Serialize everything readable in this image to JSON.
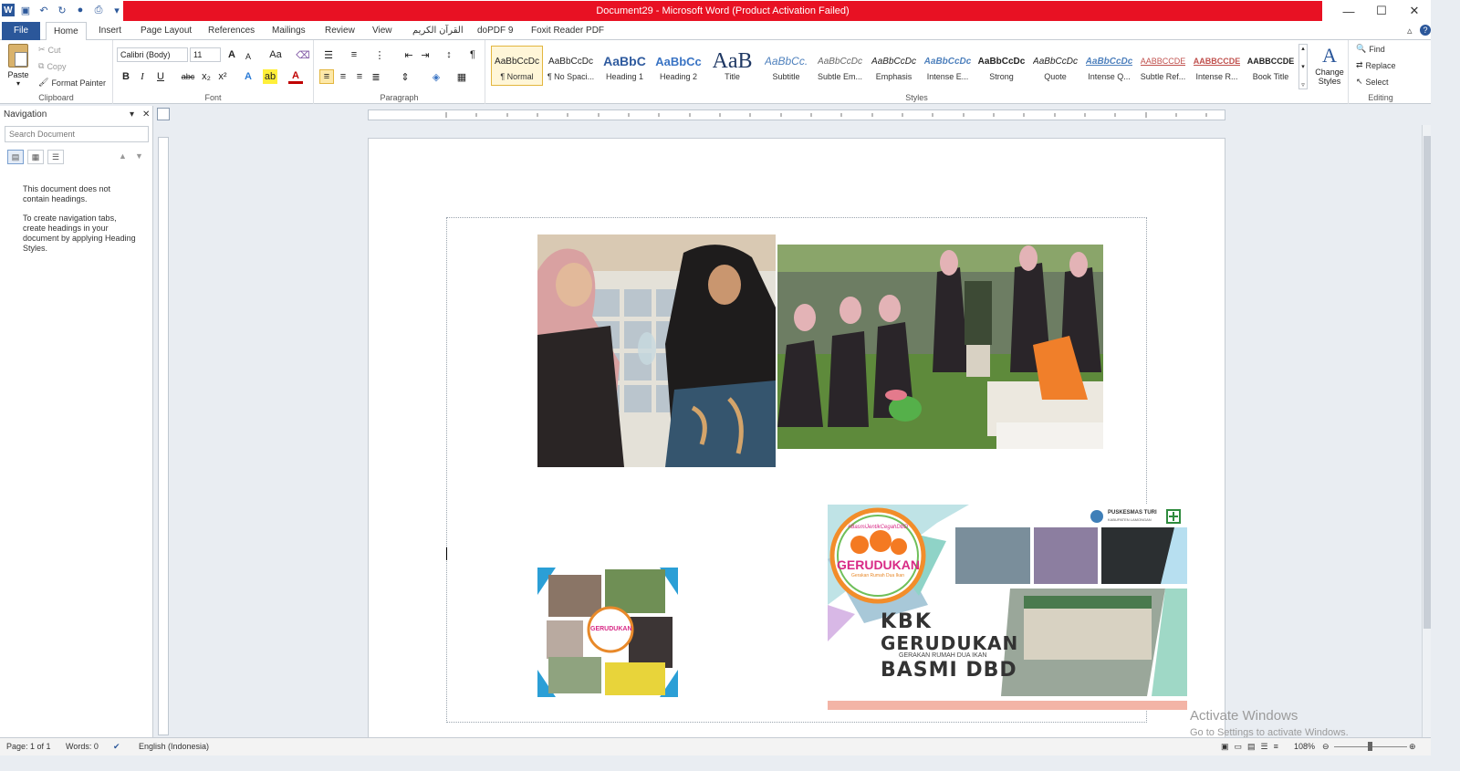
{
  "window": {
    "title": "Document29 - Microsoft Word (Product Activation Failed)",
    "minimize": "—",
    "maximize": "☐",
    "close": "✕"
  },
  "tabs": [
    "File",
    "Home",
    "Insert",
    "Page Layout",
    "References",
    "Mailings",
    "Review",
    "View",
    "القرآن الكريم",
    "doPDF 9",
    "Foxit Reader PDF"
  ],
  "ribbon": {
    "clipboard": {
      "label": "Clipboard",
      "paste": "Paste",
      "cut": "Cut",
      "copy": "Copy",
      "format_painter": "Format Painter"
    },
    "font": {
      "label": "Font",
      "family": "Calibri (Body)",
      "size": "11",
      "bold": "B",
      "italic": "I",
      "underline": "U",
      "strike": "abc",
      "sub": "x₂",
      "sup": "x²",
      "grow": "A",
      "shrink": "A",
      "case": "Aa"
    },
    "paragraph": {
      "label": "Paragraph",
      "pilcrow": "¶"
    },
    "styles": {
      "label": "Styles",
      "items": [
        {
          "preview": "AaBbCcDc",
          "name": "¶ Normal"
        },
        {
          "preview": "AaBbCcDc",
          "name": "¶ No Spaci..."
        },
        {
          "preview": "AaBbC",
          "name": "Heading 1"
        },
        {
          "preview": "AaBbCc",
          "name": "Heading 2"
        },
        {
          "preview": "AaB",
          "name": "Title"
        },
        {
          "preview": "AaBbCc.",
          "name": "Subtitle"
        },
        {
          "preview": "AaBbCcDc",
          "name": "Subtle Em..."
        },
        {
          "preview": "AaBbCcDc",
          "name": "Emphasis"
        },
        {
          "preview": "AaBbCcDc",
          "name": "Intense E..."
        },
        {
          "preview": "AaBbCcDc",
          "name": "Strong"
        },
        {
          "preview": "AaBbCcDc",
          "name": "Quote"
        },
        {
          "preview": "AaBbCcDc",
          "name": "Intense Q..."
        },
        {
          "preview": "AABBCCDE",
          "name": "Subtle Ref..."
        },
        {
          "preview": "AABBCCDE",
          "name": "Intense R..."
        },
        {
          "preview": "AABBCCDE",
          "name": "Book Title"
        }
      ],
      "change_styles": "Change Styles"
    },
    "editing": {
      "label": "Editing",
      "find": "Find",
      "replace": "Replace",
      "select": "Select"
    }
  },
  "navigation": {
    "title": "Navigation",
    "search_placeholder": "Search Document",
    "msg1": "This document does not contain headings.",
    "msg2": "To create navigation tabs, create headings in your document by applying Heading Styles."
  },
  "banner": {
    "hashtag": "#BasmiJentikCegahDBD",
    "logo": "GERUDUKAN",
    "logo_sub": "Gerakan Rumah Dua Ikan",
    "org": "PUSKESMAS TURI",
    "org_sub": "KABUPATEN LAMONGAN",
    "kbk": "KBK",
    "gerudukan": "GERUDUKAN",
    "gerakan": "GERAKAN RUMAH DUA IKAN",
    "basmi": "BASMI DBD"
  },
  "collage": {
    "logo": "GERUDUKAN"
  },
  "status": {
    "page": "Page: 1 of 1",
    "words": "Words: 0",
    "language": "English (Indonesia)",
    "zoom": "108%"
  },
  "watermark": {
    "line1": "Activate Windows",
    "line2": "Go to Settings to activate Windows."
  },
  "colors": {
    "accent": "#2b579a",
    "title_bar": "#e81123"
  }
}
